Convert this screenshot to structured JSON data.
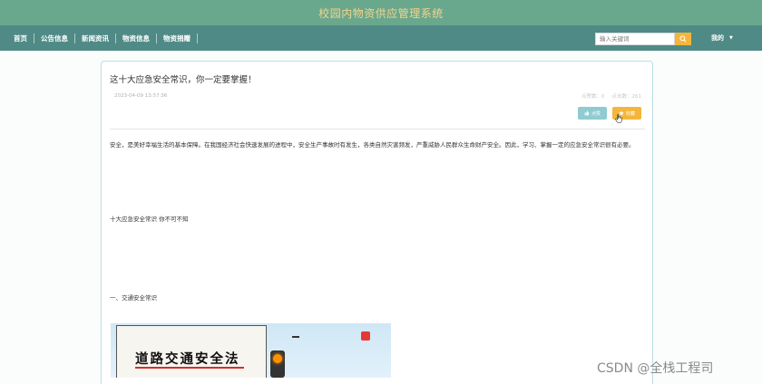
{
  "app": {
    "title": "校园内物资供应管理系统"
  },
  "nav": {
    "items": [
      {
        "label": "首页"
      },
      {
        "label": "公告信息"
      },
      {
        "label": "新闻资讯"
      },
      {
        "label": "物资信息"
      },
      {
        "label": "物资捐赠"
      }
    ],
    "search_placeholder": "输入关键词",
    "user_menu_label": "我的"
  },
  "article": {
    "title": "这十大应急安全常识，你一定要掌握！",
    "date": "2023-04-09 13:57:36",
    "likes_label": "点赞数：0",
    "clicks_label": "点击数：261",
    "like_button_label": "点赞",
    "collect_button_label": "收藏",
    "intro": "安全，是美好幸福生活的基本保障。在我国经济社会快速发展的进程中，安全生产事故时有发生，各类自然灾害频发，严重威胁人民群众生命财产安全。因此，学习、掌握一定的应急安全常识很有必要。",
    "section1": "十大应急安全常识 你不可不知",
    "section2": "一、交通安全常识",
    "image_text": "道路交通安全法"
  },
  "watermark": "CSDN @全栈工程司",
  "colors": {
    "title_bar": "#6aa88e",
    "title_text": "#f3d58a",
    "nav_bar": "#4f8a86",
    "accent_orange": "#f4b63a",
    "like_button": "#8fcbd0"
  },
  "icons": {
    "search": "search-icon",
    "caret": "caret-down-icon",
    "like": "thumb-up-icon",
    "collect": "star-icon",
    "cursor": "hand-pointer-icon"
  }
}
